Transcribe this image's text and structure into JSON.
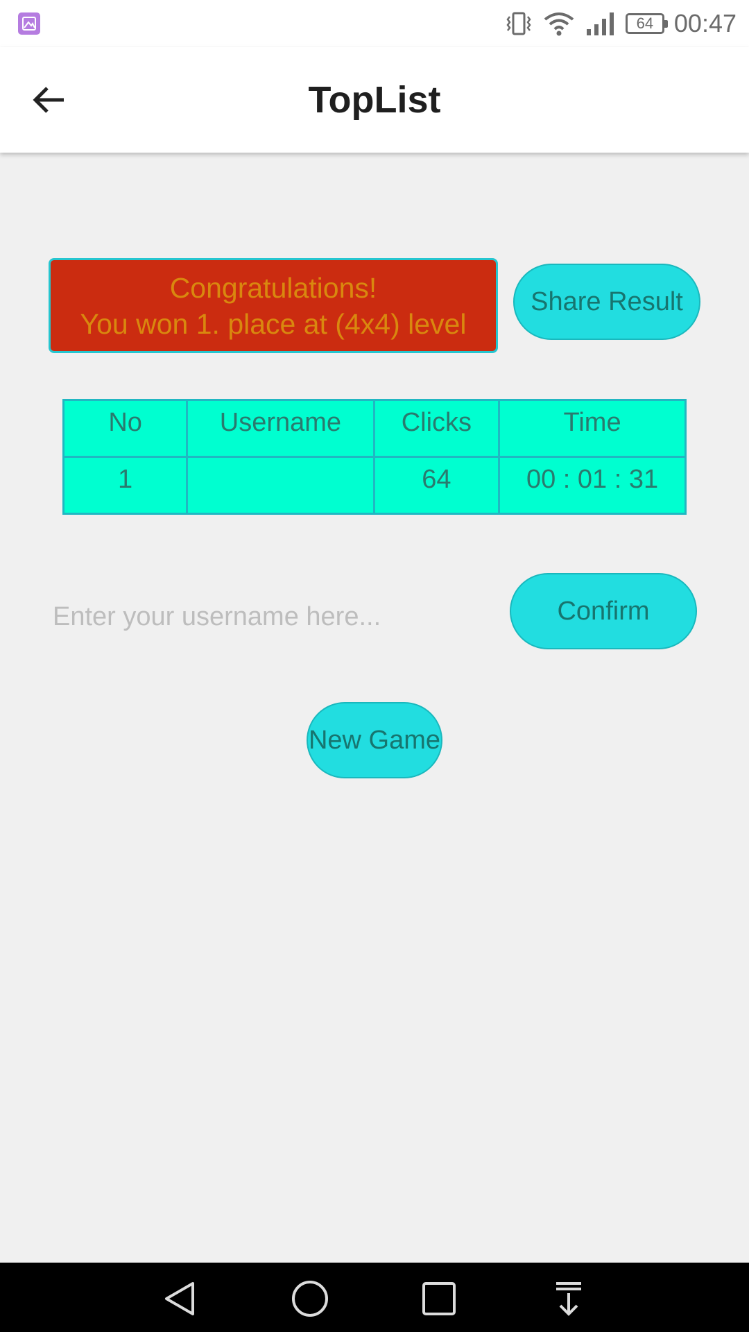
{
  "status_bar": {
    "time": "00:47",
    "battery_level": "64",
    "icons": [
      "gallery-notification-icon",
      "vibrate-icon",
      "wifi-icon",
      "signal-icon",
      "battery-icon"
    ]
  },
  "app_bar": {
    "title": "TopList",
    "back_icon": "arrow-left-icon"
  },
  "congrats": {
    "line1": "Congratulations!",
    "line2": "You won 1. place at (4x4) level"
  },
  "share_button": {
    "label": "Share Result"
  },
  "table": {
    "headers": [
      "No",
      "Username",
      "Clicks",
      "Time"
    ],
    "rows": [
      {
        "no": "1",
        "username": "",
        "clicks": "64",
        "time": "00 : 01 : 31"
      }
    ]
  },
  "username_input": {
    "value": "",
    "placeholder": "Enter your username here..."
  },
  "confirm_button": {
    "label": "Confirm"
  },
  "new_game_button": {
    "label": "New Game"
  },
  "nav_bar": {
    "icons": [
      "back-triangle-icon",
      "home-circle-icon",
      "recents-square-icon",
      "notification-pull-icon"
    ]
  },
  "colors": {
    "banner_bg": "#cb2c10",
    "banner_text": "#d9880f",
    "button_bg": "#22dde0",
    "table_bg": "#00ffd0",
    "table_border": "#21b7c2"
  }
}
